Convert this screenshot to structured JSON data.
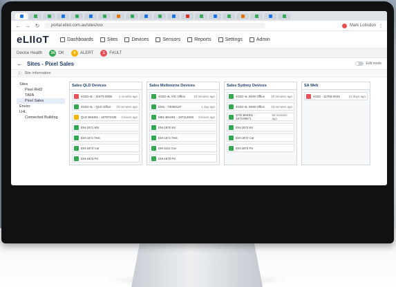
{
  "browser": {
    "url": "portal.eliiot.com.au/sites/xxx",
    "user": "Mark Lobsdon",
    "tab_colors": [
      "#1a73e8",
      "#34a853",
      "#34a853",
      "#1a73e8",
      "#34a853",
      "#1a73e8",
      "#34a853",
      "#e37400",
      "#34a853",
      "#1a73e8",
      "#34a853",
      "#1a73e8",
      "#d93025",
      "#34a853",
      "#1a73e8",
      "#34a853",
      "#e37400",
      "#34a853",
      "#1a73e8",
      "#34a853"
    ]
  },
  "app": {
    "logo": "eLIIoT",
    "nav": [
      "Dashboards",
      "Sites",
      "Devices",
      "Sensors",
      "Reports",
      "Settings",
      "Admin"
    ]
  },
  "status": {
    "label": "Device Health",
    "ok_count": "34",
    "ok_label": "OK",
    "alert_count": "0",
    "alert_label": "ALERT",
    "fault_count": "1",
    "fault_label": "FAULT",
    "colors": {
      "ok": "#34a853",
      "alert": "#f5b400",
      "fault": "#e8535b"
    }
  },
  "page": {
    "title": "Sites - Pixel Sales",
    "toggle_label": "Edit mode",
    "info": "Site information"
  },
  "tree": [
    {
      "label": "Sites",
      "level": 1
    },
    {
      "label": "Pixel RHD",
      "level": 2
    },
    {
      "label": "TAFA",
      "level": 2
    },
    {
      "label": "Pixel Sales",
      "level": 2,
      "selected": true
    },
    {
      "label": "Enviro",
      "level": 1
    },
    {
      "label": "LHL",
      "level": 1
    },
    {
      "label": "Connected Building",
      "level": 2
    }
  ],
  "columns": [
    {
      "title": "Sales QLD Devices",
      "cards": [
        {
          "name": "4G52-4L - 11973-0006",
          "time": "4 months ago",
          "status": "fault"
        },
        {
          "name": "4G52-4L - QLD Office",
          "time": "10 minutes ago",
          "status": "ok"
        },
        {
          "name": "QLD BNH01 - 187971035",
          "time": "3 hours ago",
          "status": "alert"
        },
        {
          "name": "EM-1871 MS",
          "time": "",
          "status": "ok"
        },
        {
          "name": "EM-1871 Test",
          "time": "",
          "status": "ok"
        },
        {
          "name": "EM-1873 Car",
          "time": "",
          "status": "ok"
        },
        {
          "name": "EM-1873 Pit",
          "time": "",
          "status": "ok"
        }
      ]
    },
    {
      "title": "Sales Melbourne Devices",
      "cards": [
        {
          "name": "4G52-4L VIC Office",
          "time": "10 minutes ago",
          "status": "ok"
        },
        {
          "name": "EM1 - 73009137",
          "time": "1 day ago",
          "status": "ok"
        },
        {
          "name": "MEL BNH01 - 187113029",
          "time": "8 hours ago",
          "status": "ok"
        },
        {
          "name": "EM-1870 Kit",
          "time": "",
          "status": "ok"
        },
        {
          "name": "EM-1871 Test",
          "time": "",
          "status": "ok"
        },
        {
          "name": "EM-1112 Car",
          "time": "",
          "status": "ok"
        },
        {
          "name": "EM-1870 Pit",
          "time": "",
          "status": "ok"
        }
      ]
    },
    {
      "title": "Sales Sydney Devices",
      "cards": [
        {
          "name": "4G52-4L NSW Office",
          "time": "20 minutes ago",
          "status": "ok"
        },
        {
          "name": "4G52-4L NSW Office",
          "time": "43 minutes ago",
          "status": "ok"
        },
        {
          "name": "SYD BNH01 - 187109871",
          "time": "55 minutes ago",
          "status": "ok"
        },
        {
          "name": "EM-1872 Kit",
          "time": "",
          "status": "ok"
        },
        {
          "name": "EM-1872 Car",
          "time": "",
          "status": "ok"
        },
        {
          "name": "EM-1872 Pit",
          "time": "",
          "status": "ok"
        }
      ]
    },
    {
      "title": "SA Web",
      "cards": [
        {
          "name": "4G52 - 11765-0044",
          "time": "10 days ago",
          "status": "fault"
        }
      ]
    }
  ]
}
